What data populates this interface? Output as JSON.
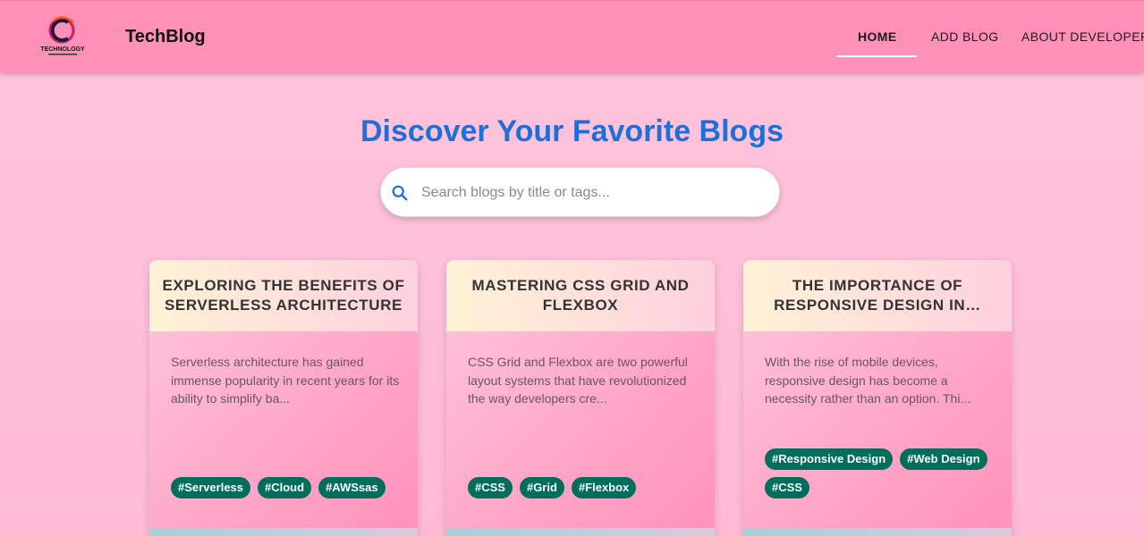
{
  "header": {
    "logo_text": "TECHNOLOGY",
    "brand": "TechBlog",
    "nav": [
      {
        "label": "HOME",
        "active": true
      },
      {
        "label": "ADD BLOG",
        "active": false
      },
      {
        "label": "ABOUT DEVELOPER",
        "active": false
      }
    ]
  },
  "hero": {
    "title": "Discover Your Favorite Blogs",
    "search_placeholder": "Search blogs by title or tags..."
  },
  "cards": [
    {
      "title": "EXPLORING THE BENEFITS OF SERVERLESS ARCHITECTURE",
      "excerpt": "Serverless architecture has gained immense popularity in recent years for its ability to simplify ba...",
      "tags": [
        "#Serverless",
        "#Cloud",
        "#AWSsas"
      ]
    },
    {
      "title": "MASTERING CSS GRID AND FLEXBOX",
      "excerpt": "CSS Grid and Flexbox are two powerful layout systems that have revolutionized the way developers cre...",
      "tags": [
        "#CSS",
        "#Grid",
        "#Flexbox"
      ]
    },
    {
      "title": "THE IMPORTANCE OF RESPONSIVE DESIGN IN…",
      "excerpt": "With the rise of mobile devices, responsive design has become a necessity rather than an option. Thi...",
      "tags": [
        "#Responsive Design",
        "#Web Design",
        "#CSS"
      ]
    }
  ],
  "colors": {
    "appbar": "#ff91b8",
    "hero_title": "#1e6fd9",
    "tag": "#006e5b"
  }
}
